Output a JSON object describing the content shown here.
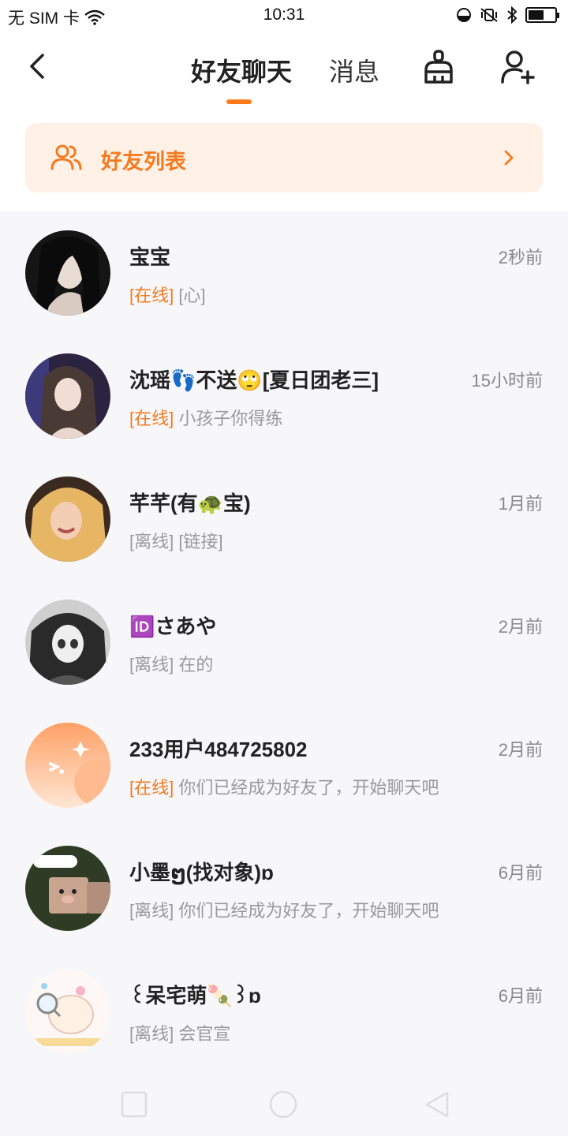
{
  "status_bar": {
    "carrier": "无 SIM 卡",
    "time": "10:31",
    "battery_level": 0.6
  },
  "header": {
    "tabs": [
      {
        "label": "好友聊天",
        "active": true
      },
      {
        "label": "消息",
        "active": false
      }
    ],
    "icons": [
      "back-icon",
      "broom-icon",
      "add-user-icon"
    ]
  },
  "friends_card": {
    "label": "好友列表"
  },
  "accent": "#f57a1f",
  "conversations": [
    {
      "name": "宝宝",
      "time": "2秒前",
      "status": "[在线]",
      "online": true,
      "preview": "[心]"
    },
    {
      "name": "沈瑶👣不送🙄[夏日团老三]",
      "time": "15小时前",
      "status": "[在线]",
      "online": true,
      "preview": "小孩子你得练"
    },
    {
      "name": "芊芊(有🐢宝)",
      "time": "1月前",
      "status": "[离线]",
      "online": false,
      "preview": "[链接]"
    },
    {
      "name": "🆔さあや",
      "time": "2月前",
      "status": "[离线]",
      "online": false,
      "preview": "在的"
    },
    {
      "name": "233用户484725802",
      "time": "2月前",
      "status": "[在线]",
      "online": true,
      "preview": "你们已经成为好友了，开始聊天吧"
    },
    {
      "name": "小墨ໆ(找对象)ɒ",
      "time": "6月前",
      "status": "[离线]",
      "online": false,
      "preview": "你们已经成为好友了，开始聊天吧"
    },
    {
      "name": "꒰呆宅萌🍡꒱ɒ",
      "time": "6月前",
      "status": "[离线]",
      "online": false,
      "preview": "会官宣"
    }
  ],
  "nav_bar": {
    "icons": [
      "recents-square-icon",
      "home-circle-icon",
      "back-triangle-icon"
    ]
  }
}
